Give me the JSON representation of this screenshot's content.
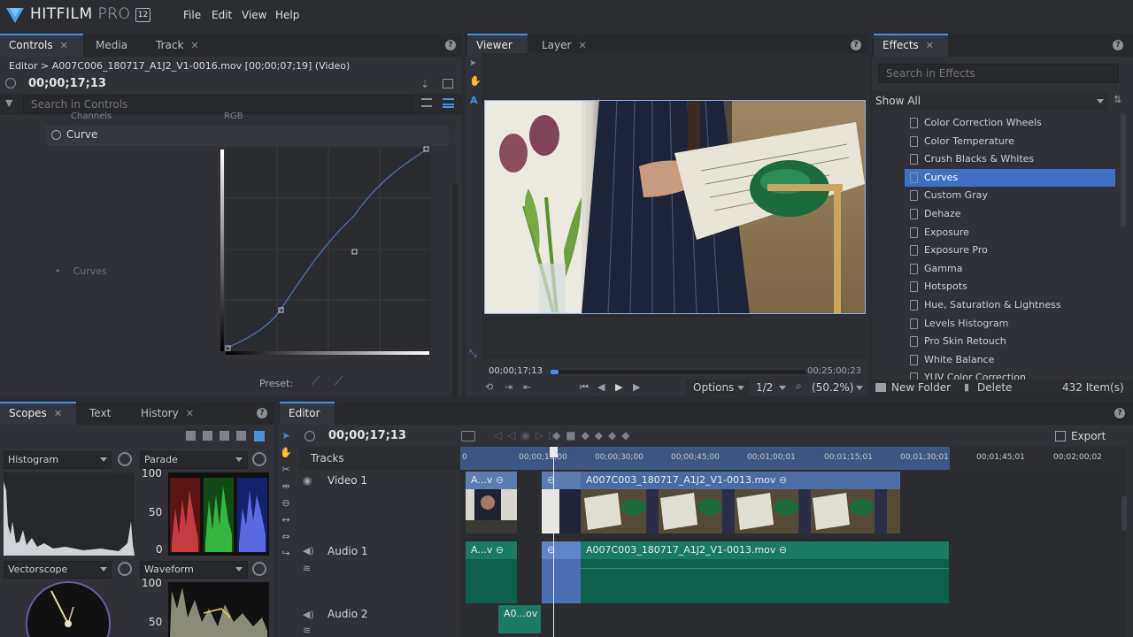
{
  "app": {
    "name": "HITFILM",
    "edition": "PRO",
    "version": "12"
  },
  "menu": [
    "File",
    "Edit",
    "View",
    "Help"
  ],
  "controls_panel": {
    "tabs": [
      "Controls",
      "Media",
      "Track"
    ],
    "breadcrumb": "Editor > A007C006_180717_A1J2_V1-0016.mov [00;00;07;19] (Video)",
    "timecode": "00;00;17;13",
    "search_placeholder": "Search in Controls",
    "channels_label": "Channels",
    "channels_value": "RGB",
    "curve_label": "Curve",
    "curves_label": "Curves",
    "preset_label": "Preset:"
  },
  "viewer_panel": {
    "tabs": [
      "Viewer",
      "Layer"
    ],
    "current_time": "00;00;17;13",
    "duration": "00;25;00;23",
    "options_label": "Options",
    "resolution": "1/2",
    "zoom": "(50.2%)",
    "playhead_fraction": 0.03
  },
  "effects_panel": {
    "tab": "Effects",
    "search_placeholder": "Search in Effects",
    "filter": "Show All",
    "items": [
      "Color Correction Wheels",
      "Color Temperature",
      "Crush Blacks & Whites",
      "Curves",
      "Custom Gray",
      "Dehaze",
      "Exposure",
      "Exposure Pro",
      "Gamma",
      "Hotspots",
      "Hue, Saturation & Lightness",
      "Levels Histogram",
      "Pro Skin Retouch",
      "White Balance",
      "YUV Color Correction"
    ],
    "selected_item": "Curves",
    "new_folder": "New Folder",
    "delete": "Delete",
    "count": "432 Item(s)"
  },
  "scopes_panel": {
    "tabs": [
      "Scopes",
      "Text",
      "History"
    ],
    "histogram": "Histogram",
    "parade": "Parade",
    "vectorscope": "Vectorscope",
    "waveform": "Waveform",
    "scale_100": "100",
    "scale_50": "50",
    "scale_0": "0"
  },
  "editor_panel": {
    "tab": "Editor",
    "timecode": "00;00;17;13",
    "export_label": "Export",
    "tracks_label": "Tracks",
    "ruler": [
      "0",
      "00;00;15;00",
      "00;00;30;00",
      "00;00;45;00",
      "00;01;00;01",
      "00;01;15;01",
      "00;01;30;01",
      "00;01;45;01",
      "00;02;00;02"
    ],
    "tracks": {
      "video1": "Video 1",
      "audio1": "Audio 1",
      "audio2": "Audio 2"
    },
    "clips": {
      "v_short": "A...v",
      "v_main": "A007C003_180717_A1J2_V1-0013.mov",
      "a_short": "A...v",
      "a_main": "A007C003_180717_A1J2_V1-0013.mov",
      "a2": "A0...ov"
    }
  },
  "colors": {
    "accent": "#4a90e2",
    "selection": "#3f6fc4",
    "video_clip": "#5d7bb0",
    "audio_clip": "#0f5f4d"
  }
}
